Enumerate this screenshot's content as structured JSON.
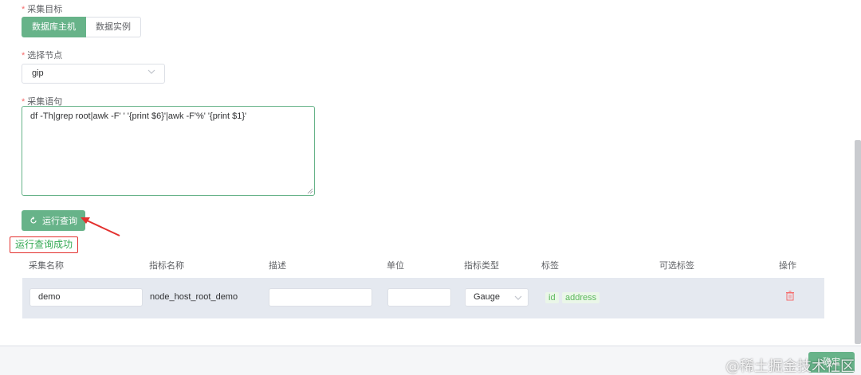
{
  "form": {
    "target_label": "采集目标",
    "target_options": [
      "数据库主机",
      "数据实例"
    ],
    "node_label": "选择节点",
    "node_value": "gip",
    "statement_label": "采集语句",
    "statement_value": "df -Th|grep root|awk -F' ' '{print $6}'|awk -F'%' '{print $1}'",
    "run_button": "运行查询",
    "run_status": "运行查询成功"
  },
  "table": {
    "headers": [
      "采集名称",
      "指标名称",
      "描述",
      "单位",
      "指标类型",
      "标签",
      "可选标签",
      "操作"
    ],
    "rows": [
      {
        "collect_name": "demo",
        "metric_name": "node_host_root_demo",
        "description": "",
        "unit": "",
        "metric_type": "Gauge",
        "tags": [
          "id",
          "address"
        ],
        "optional_tags": ""
      }
    ]
  },
  "footer": {
    "button": "确定"
  },
  "watermark": "@稀土掘金技术社区",
  "colors": {
    "accent": "#67b389",
    "danger": "#f56c6c",
    "success_text": "#32a852",
    "annotation": "#e3302e"
  },
  "icons": {
    "refresh": "refresh-icon",
    "chevron": "chevron-down-icon",
    "delete": "trash-icon"
  }
}
